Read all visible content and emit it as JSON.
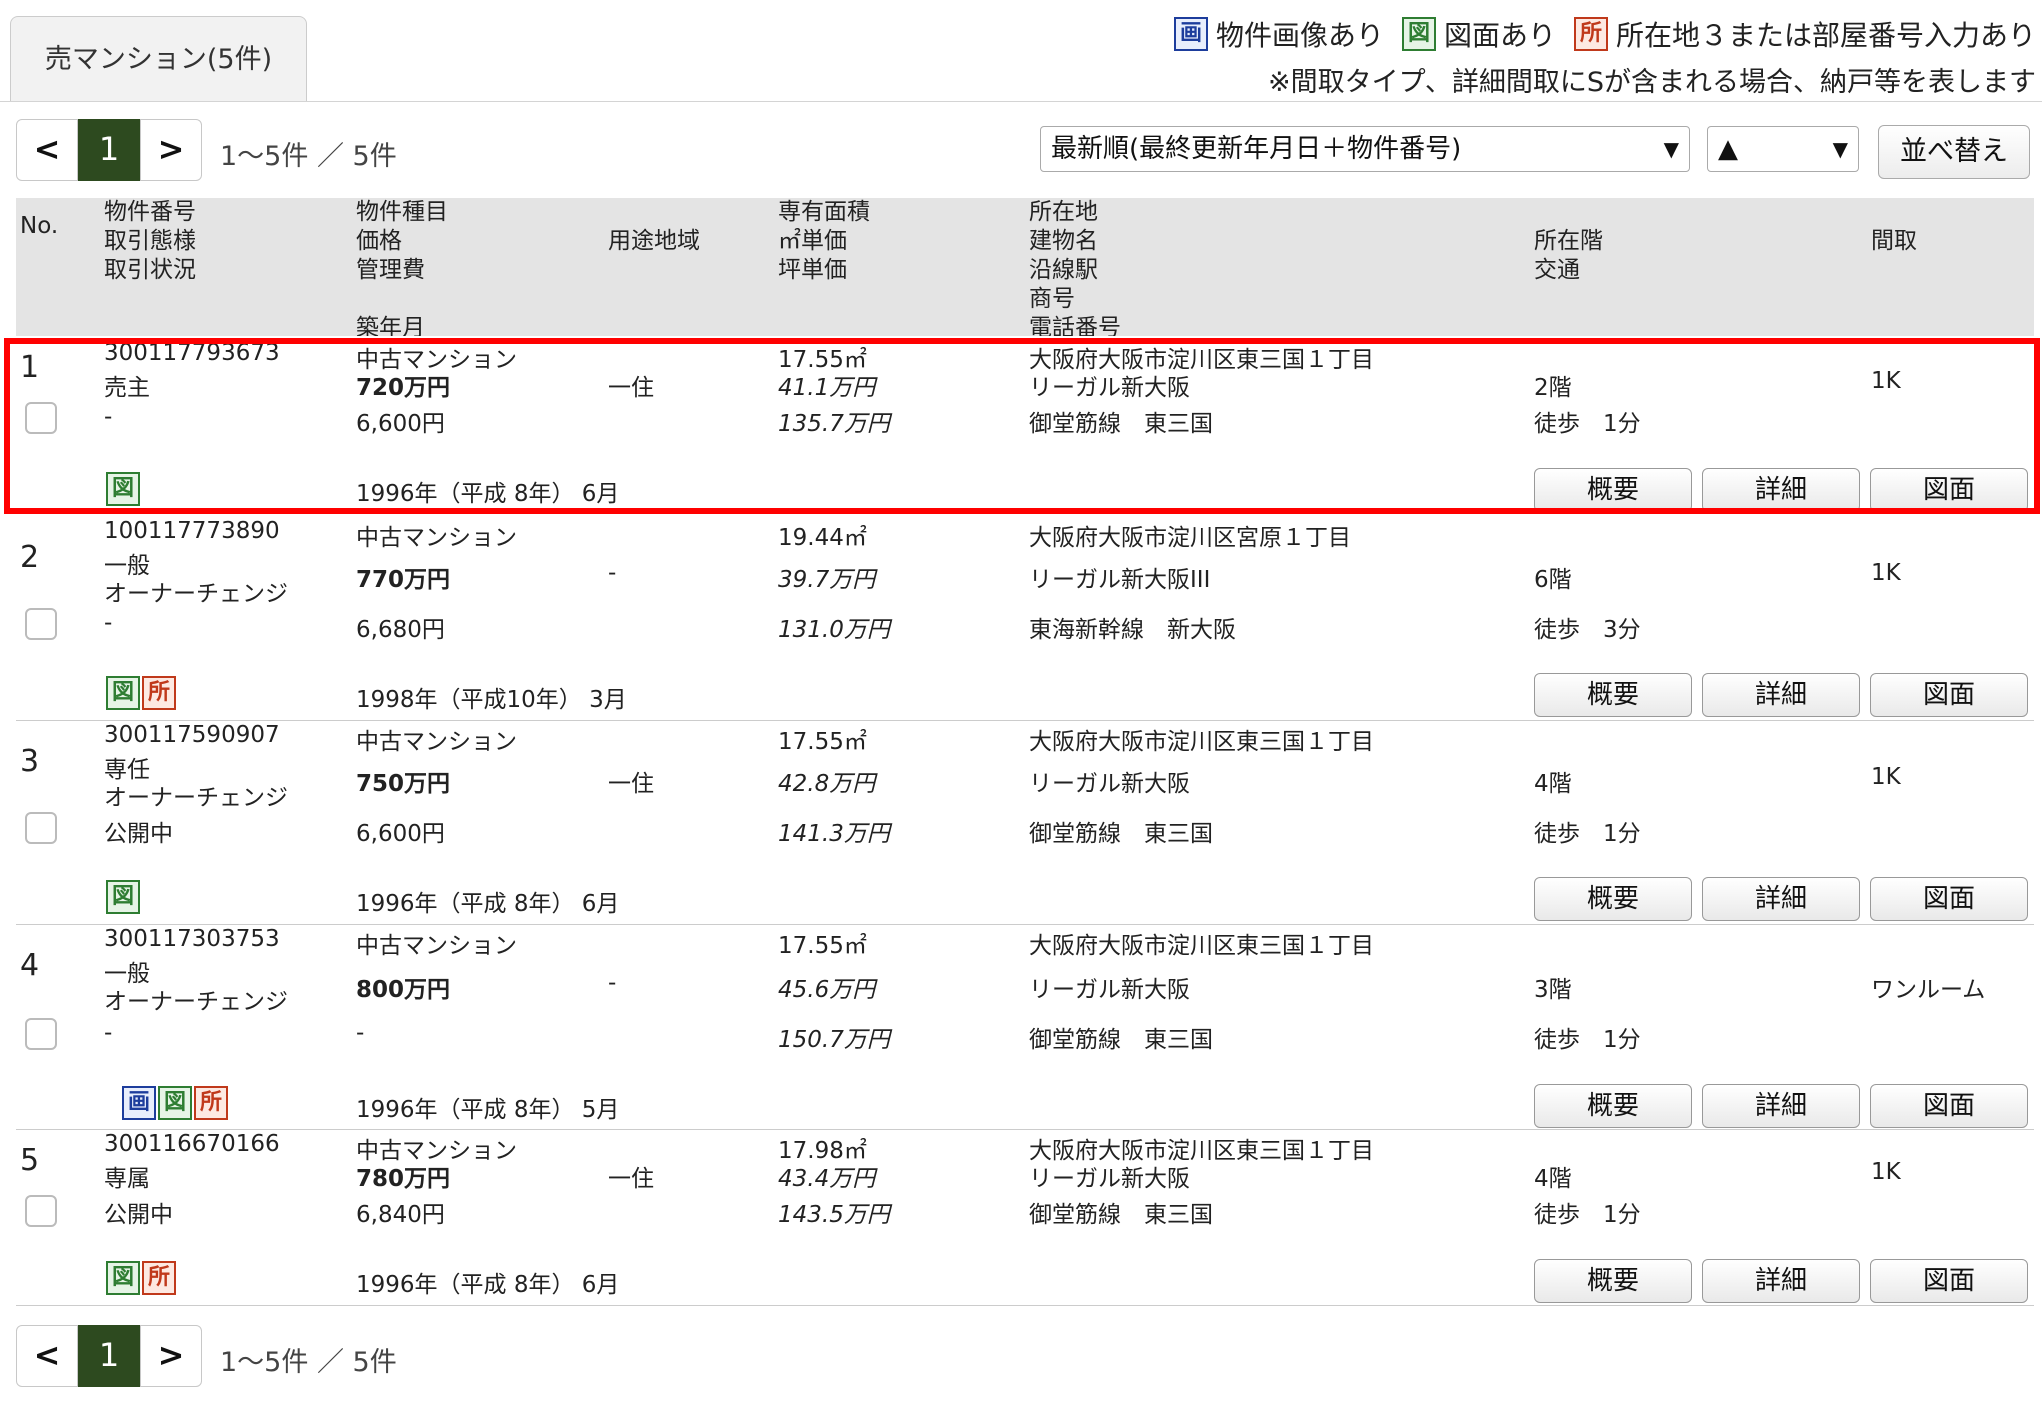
{
  "tab_label": "売マンション(5件)",
  "legend": {
    "items": [
      {
        "badge": "画",
        "label": "物件画像あり",
        "cls": "b-img"
      },
      {
        "badge": "図",
        "label": "図面あり",
        "cls": "b-plan"
      },
      {
        "badge": "所",
        "label": "所在地３または部屋番号入力あり",
        "cls": "b-loc"
      }
    ],
    "note": "※間取タイプ、詳細間取にSが含まれる場合、納戸等を表します"
  },
  "pager": {
    "prev": "<",
    "current": "1",
    "next": ">",
    "count": "1〜5件 ／ 5件"
  },
  "sort": {
    "field": "最新順(最終更新年月日＋物件番号)",
    "direction": "▲",
    "button": "並べ替え"
  },
  "headers": {
    "no": "No.",
    "col1": "物件番号\n取引態様\n取引状況",
    "col2": "物件種目\n価格\n管理費\n\n築年月",
    "col3": "用途地域",
    "col4": "専有面積\n㎡単価\n坪単価",
    "col5": "所在地\n建物名\n沿線駅\n商号\n電話番号",
    "col6": "所在階\n交通",
    "col7": "間取"
  },
  "action_labels": {
    "overview": "概要",
    "detail": "詳細",
    "plan": "図面"
  },
  "rows": [
    {
      "no": "1",
      "id": "300117793673",
      "deal": "売主",
      "status": "-",
      "type": "中古マンション",
      "price": "720万円",
      "fee": "6,600円",
      "built": "1996年（平成 8年） 6月",
      "zone": "一住",
      "area": "17.55㎡",
      "sqm": "41.1万円",
      "tsubo": "135.7万円",
      "address": "大阪府大阪市淀川区東三国１丁目",
      "building": "リーガル新大阪",
      "station": "御堂筋線　東三国",
      "floor": "2階",
      "access": "徒歩　1分",
      "layout": "1K",
      "badges": [
        "図"
      ]
    },
    {
      "no": "2",
      "id": "100117773890",
      "deal": "一般",
      "status": "オーナーチェンジ",
      "status2": "-",
      "type": "中古マンション",
      "price": "770万円",
      "fee": "6,680円",
      "built": "1998年（平成10年） 3月",
      "zone": "-",
      "area": "19.44㎡",
      "sqm": "39.7万円",
      "tsubo": "131.0万円",
      "address": "大阪府大阪市淀川区宮原１丁目",
      "building": "リーガル新大阪III",
      "station": "東海新幹線　新大阪",
      "floor": "6階",
      "access": "徒歩　3分",
      "layout": "1K",
      "badges": [
        "図",
        "所"
      ]
    },
    {
      "no": "3",
      "id": "300117590907",
      "deal": "専任",
      "status": "オーナーチェンジ",
      "status2": "公開中",
      "type": "中古マンション",
      "price": "750万円",
      "fee": "6,600円",
      "built": "1996年（平成 8年） 6月",
      "zone": "一住",
      "area": "17.55㎡",
      "sqm": "42.8万円",
      "tsubo": "141.3万円",
      "address": "大阪府大阪市淀川区東三国１丁目",
      "building": "リーガル新大阪",
      "station": "御堂筋線　東三国",
      "floor": "4階",
      "access": "徒歩　1分",
      "layout": "1K",
      "badges": [
        "図"
      ]
    },
    {
      "no": "4",
      "id": "300117303753",
      "deal": "一般",
      "status": "オーナーチェンジ",
      "status2": "-",
      "type": "中古マンション",
      "price": "800万円",
      "fee": "-",
      "built": "1996年（平成 8年） 5月",
      "zone": "-",
      "area": "17.55㎡",
      "sqm": "45.6万円",
      "tsubo": "150.7万円",
      "address": "大阪府大阪市淀川区東三国１丁目",
      "building": "リーガル新大阪",
      "station": "御堂筋線　東三国",
      "floor": "3階",
      "access": "徒歩　1分",
      "layout": "ワンルーム",
      "badges": [
        "画",
        "図",
        "所"
      ]
    },
    {
      "no": "5",
      "id": "300116670166",
      "deal": "専属",
      "status": "公開中",
      "type": "中古マンション",
      "price": "780万円",
      "fee": "6,840円",
      "built": "1996年（平成 8年） 6月",
      "zone": "一住",
      "area": "17.98㎡",
      "sqm": "43.4万円",
      "tsubo": "143.5万円",
      "address": "大阪府大阪市淀川区東三国１丁目",
      "building": "リーガル新大阪",
      "station": "御堂筋線　東三国",
      "floor": "4階",
      "access": "徒歩　1分",
      "layout": "1K",
      "badges": [
        "図",
        "所"
      ]
    }
  ]
}
